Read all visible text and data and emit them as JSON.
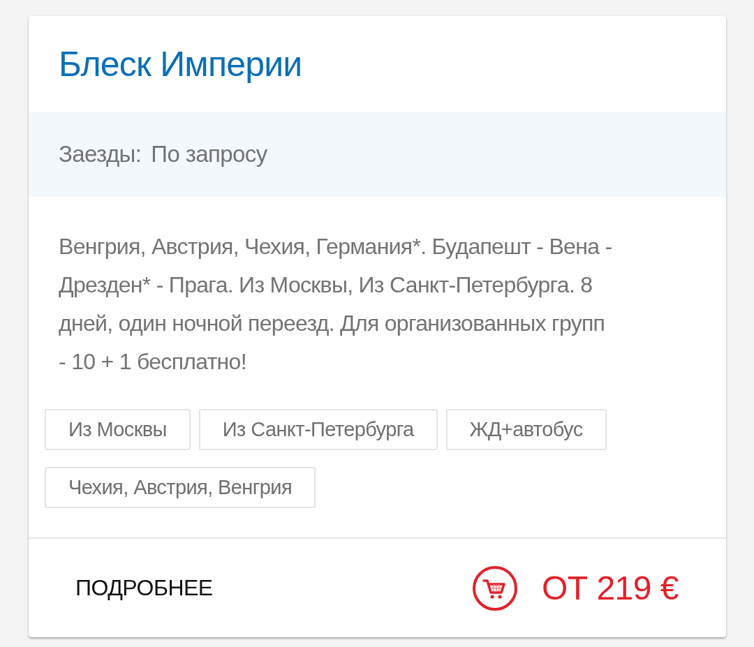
{
  "card": {
    "title": "Блеск Империи",
    "schedule": {
      "label": "Заезды:",
      "value": "По запросу"
    },
    "description": "Венгрия, Австрия, Чехия, Германия*. Будапешт - Вена - Дрезден* - Прага. Из Москвы, Из Санкт-Петербурга. 8 дней, один ночной переезд. Для организованных групп - 10 + 1 бесплатно!",
    "tags": [
      "Из Москвы",
      "Из Санкт-Петербурга",
      "ЖД+автобус",
      "Чехия, Австрия, Венгрия"
    ],
    "footer": {
      "details_link": "ПОДРОБНЕЕ",
      "price": "ОТ 219 €"
    }
  }
}
